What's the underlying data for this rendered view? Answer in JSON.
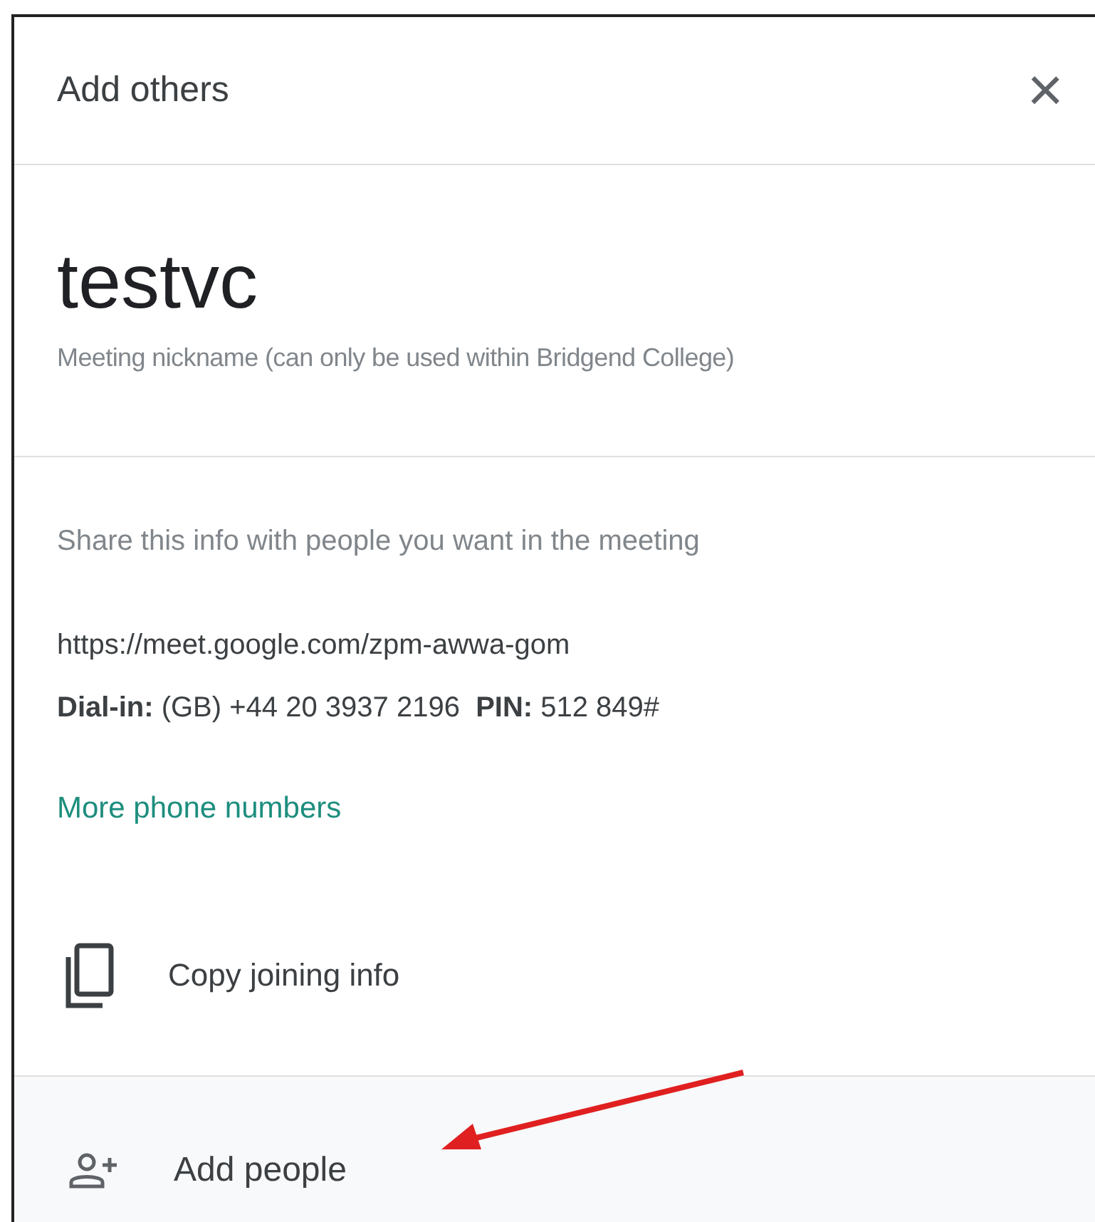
{
  "dialog": {
    "title": "Add others",
    "close": "×"
  },
  "meeting": {
    "name": "testvc",
    "caption": "Meeting nickname (can only be used within Bridgend College)"
  },
  "share": {
    "intro": "Share this info with people you want in the meeting",
    "url": "https://meet.google.com/zpm-awwa-gom",
    "dial_in": "**Dial-in:** (GB) +44 20 3937 2196  **PIN:** 512 849#",
    "more_link": "More phone numbers",
    "copy_action": "Copy joining info"
  },
  "footer": {
    "action": "Add people"
  }
}
